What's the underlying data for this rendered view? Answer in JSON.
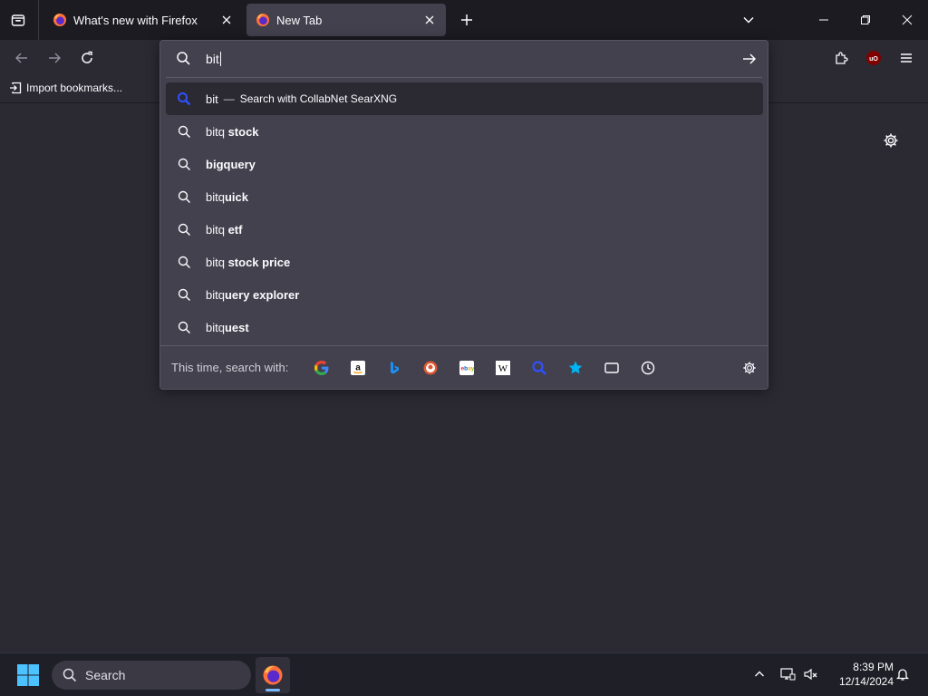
{
  "tabs": [
    {
      "title": "What's new with Firefox",
      "active": false
    },
    {
      "title": "New Tab",
      "active": true
    }
  ],
  "bookmarks": {
    "import_label": "Import bookmarks..."
  },
  "urlbar": {
    "typed": "bit",
    "results": [
      {
        "typed": "bit",
        "rest": "",
        "engine_label": "Search with CollabNet SearXNG",
        "type": "search-engine"
      },
      {
        "typed": "bitq",
        "rest": " stock",
        "type": "suggestion"
      },
      {
        "typed": "bi",
        "rest": "gquery",
        "type": "suggestion"
      },
      {
        "typed": "bitq",
        "rest": "uick",
        "type": "suggestion"
      },
      {
        "typed": "bitq",
        "rest": " etf",
        "type": "suggestion"
      },
      {
        "typed": "bitq",
        "rest": " stock price",
        "type": "suggestion"
      },
      {
        "typed": "bitq",
        "rest": "uery explorer",
        "type": "suggestion"
      },
      {
        "typed": "bitq",
        "rest": "uest",
        "type": "suggestion"
      }
    ],
    "oneoff_label": "This time, search with:",
    "engines": [
      "google-icon",
      "amazon-icon",
      "bing-icon",
      "duckduckgo-icon",
      "ebay-icon",
      "wikipedia-icon",
      "searxng-icon",
      "bookmarks-icon",
      "tabs-icon",
      "history-icon"
    ]
  },
  "taskbar": {
    "search_label": "Search",
    "time": "8:39 PM",
    "date": "12/14/2024"
  },
  "colors": {
    "accent": "#7ab8ff",
    "searxng": "#3050ff",
    "bookmark_star": "#00b3f4"
  }
}
